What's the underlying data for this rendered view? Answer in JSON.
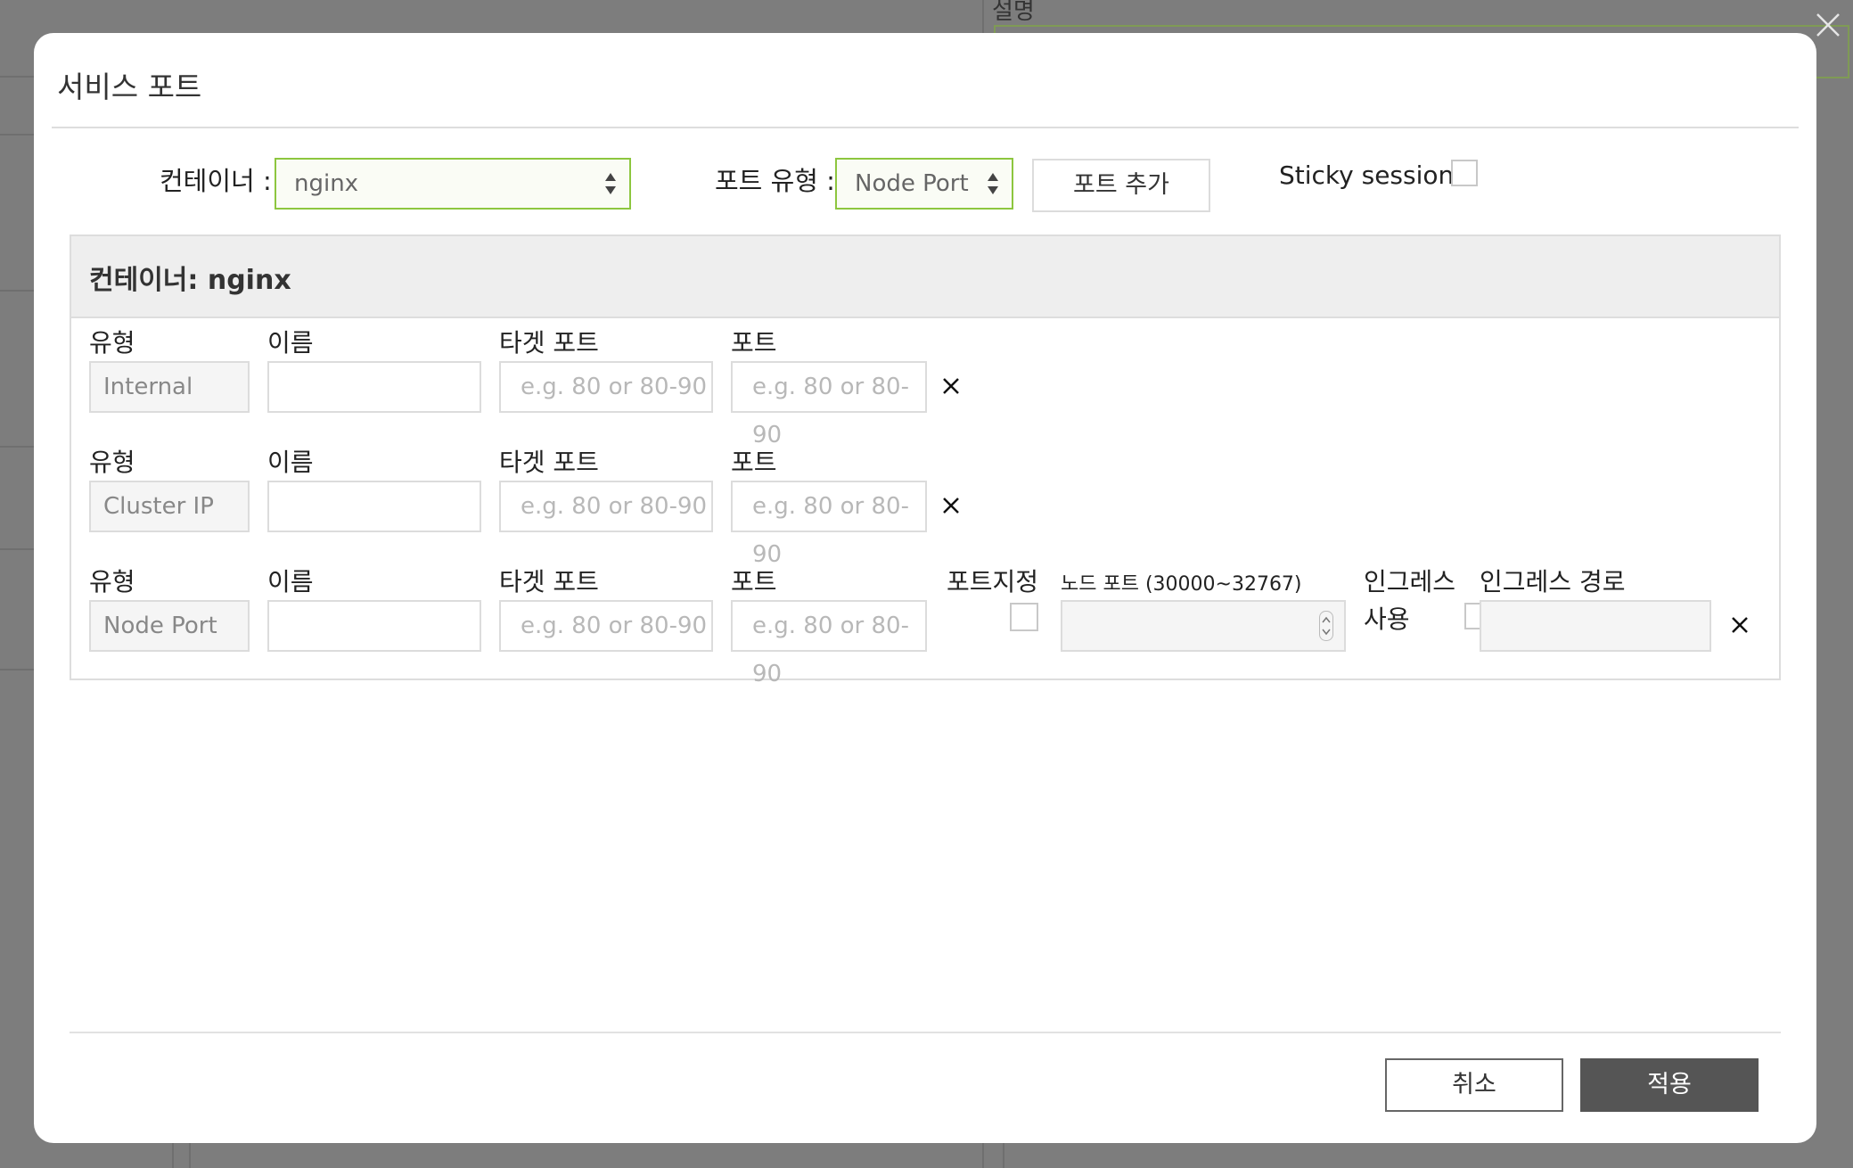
{
  "background": {
    "field_label": "설명"
  },
  "dialog": {
    "title": "서비스 포트",
    "container_label": "컨테이너 :",
    "container_select_value": "nginx",
    "port_type_label": "포트 유형 :",
    "port_type_select_value": "Node Port",
    "add_port_button": "포트 추가",
    "sticky_session_label": "Sticky session",
    "sticky_session_checked": false,
    "container_section_title": "컨테이너: nginx",
    "field_labels": {
      "type": "유형",
      "name": "이름",
      "target_port": "타겟 포트",
      "port": "포트",
      "port_assign": "포트지정",
      "node_port": "노드 포트 (30000~32767)",
      "ingress_use_line1": "인그레스",
      "ingress_use_line2": "사용",
      "ingress_path": "인그레스 경로"
    },
    "port_placeholder": "e.g. 80 or 80-90",
    "rows": [
      {
        "type": "Internal",
        "name": ""
      },
      {
        "type": "Cluster IP",
        "name": ""
      },
      {
        "type": "Node Port",
        "name": "",
        "port_assign_checked": false,
        "ingress_checked": false
      }
    ],
    "cancel_button": "취소",
    "apply_button": "적용"
  },
  "colors": {
    "accent_green": "#8dc63f",
    "apply_bg": "#555555",
    "overlay": "#7d7d7d"
  }
}
